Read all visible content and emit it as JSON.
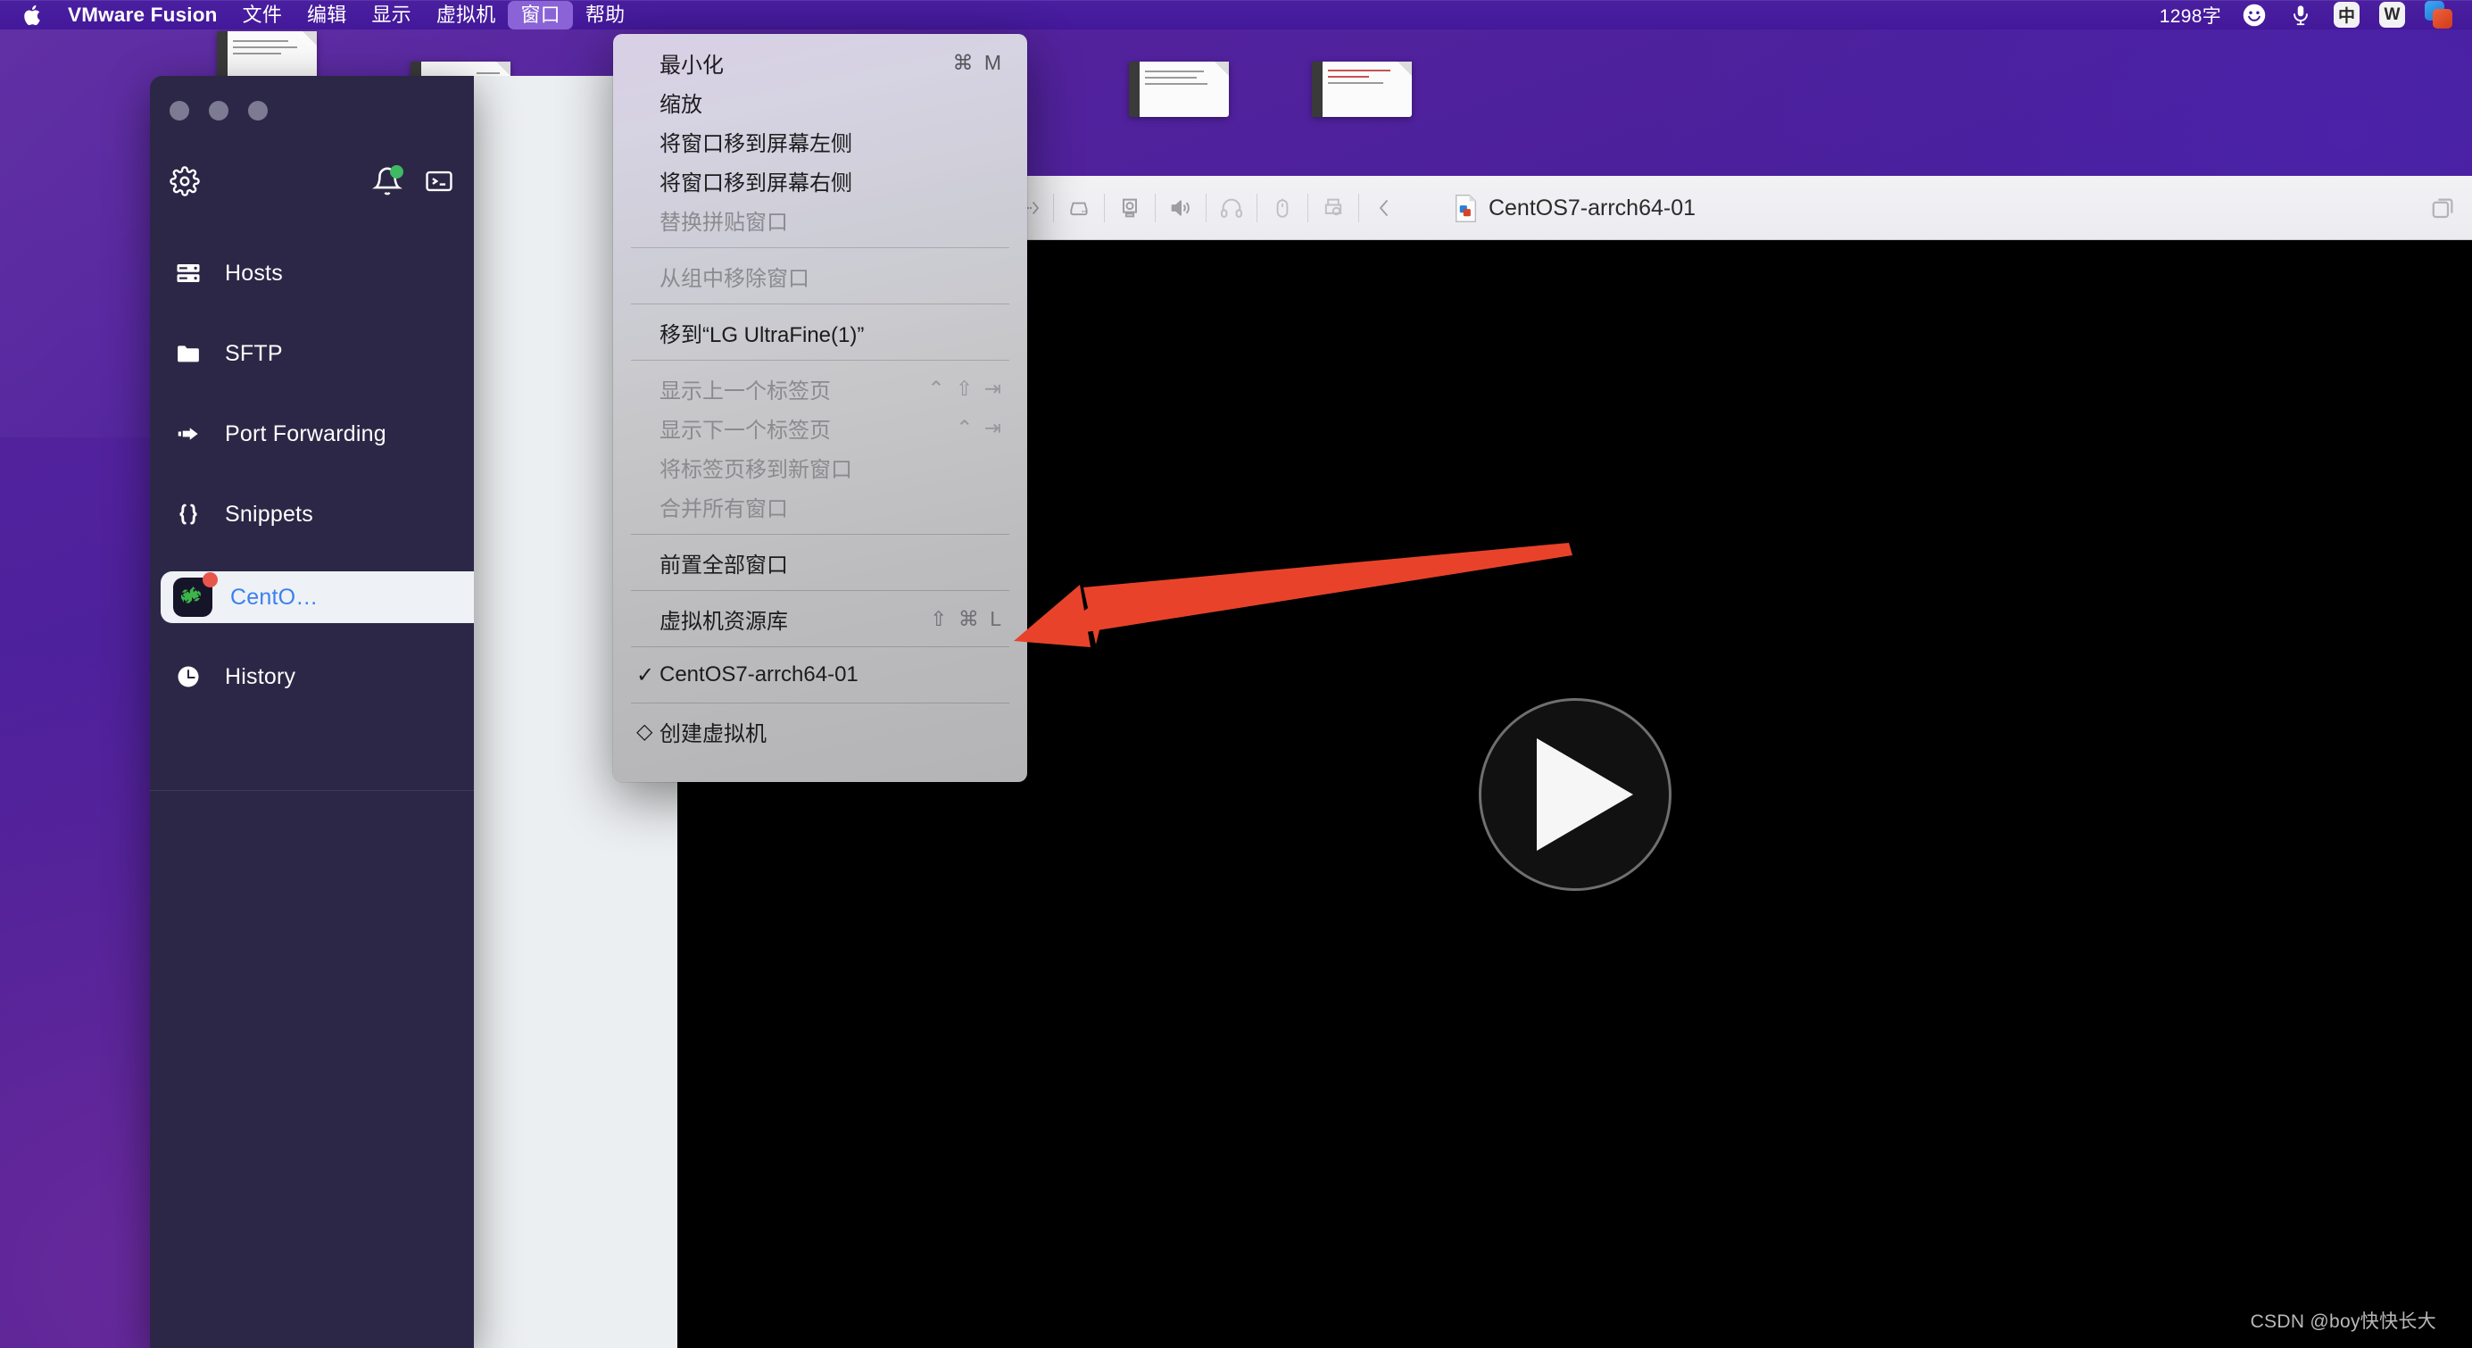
{
  "menubar": {
    "apple_icon": "apple-logo-icon",
    "app_name": "VMware Fusion",
    "items": [
      {
        "label": "文件",
        "active": false
      },
      {
        "label": "编辑",
        "active": false
      },
      {
        "label": "显示",
        "active": false
      },
      {
        "label": "虚拟机",
        "active": false
      },
      {
        "label": "窗口",
        "active": true
      },
      {
        "label": "帮助",
        "active": false
      }
    ],
    "status": {
      "word_count": "1298字",
      "smiley_icon": "smiley-face-icon",
      "microphone_icon": "microphone-icon",
      "ime_label": "中",
      "wps_label": "W",
      "vmware_icon": "vmware-fusion-icon"
    }
  },
  "window_menu": {
    "groups": [
      [
        {
          "label": "最小化",
          "shortcut": "⌘ M",
          "enabled": true,
          "mark": ""
        },
        {
          "label": "缩放",
          "shortcut": "",
          "enabled": true,
          "mark": ""
        },
        {
          "label": "将窗口移到屏幕左侧",
          "shortcut": "",
          "enabled": true,
          "mark": ""
        },
        {
          "label": "将窗口移到屏幕右侧",
          "shortcut": "",
          "enabled": true,
          "mark": ""
        },
        {
          "label": "替换拼贴窗口",
          "shortcut": "",
          "enabled": false,
          "mark": ""
        }
      ],
      [
        {
          "label": "从组中移除窗口",
          "shortcut": "",
          "enabled": false,
          "mark": ""
        }
      ],
      [
        {
          "label": "移到“LG UltraFine(1)”",
          "shortcut": "",
          "enabled": true,
          "mark": ""
        }
      ],
      [
        {
          "label": "显示上一个标签页",
          "shortcut": "⌃ ⇧ ⇥",
          "enabled": false,
          "mark": ""
        },
        {
          "label": "显示下一个标签页",
          "shortcut": "⌃ ⇥",
          "enabled": false,
          "mark": ""
        },
        {
          "label": "将标签页移到新窗口",
          "shortcut": "",
          "enabled": false,
          "mark": ""
        },
        {
          "label": "合并所有窗口",
          "shortcut": "",
          "enabled": false,
          "mark": ""
        }
      ],
      [
        {
          "label": "前置全部窗口",
          "shortcut": "",
          "enabled": true,
          "mark": ""
        }
      ],
      [
        {
          "label": "虚拟机资源库",
          "shortcut": "⇧ ⌘ L",
          "enabled": true,
          "mark": ""
        }
      ],
      [
        {
          "label": "CentOS7-arrch64-01",
          "shortcut": "",
          "enabled": true,
          "mark": "✓"
        }
      ],
      [
        {
          "label": "创建虚拟机",
          "shortcut": "",
          "enabled": true,
          "mark": "◇"
        }
      ]
    ]
  },
  "terminal_app": {
    "traffic_lights": [
      "close-button",
      "minimize-button",
      "maximize-button"
    ],
    "toolbar": {
      "settings_icon": "gear-icon",
      "notifications_icon": "bell-icon",
      "notification_dot_color": "#3fb964",
      "terminal_icon": "terminal-icon"
    },
    "nav_items": [
      {
        "label": "Hosts",
        "icon": "server-icon",
        "selected": false
      },
      {
        "label": "SFTP",
        "icon": "folder-icon",
        "selected": false
      },
      {
        "label": "Port Forwarding",
        "icon": "port-forward-arrow-icon",
        "selected": false
      },
      {
        "label": "Snippets",
        "icon": "braces-icon",
        "selected": false
      },
      {
        "label": "CentO…",
        "icon": "centos-icon",
        "selected": true,
        "badge_color": "#e8554c"
      },
      {
        "label": "History",
        "icon": "clock-icon",
        "selected": false
      }
    ]
  },
  "vmware_window": {
    "title": "CentOS7-arrch64-01",
    "title_icon": "vm-document-icon",
    "toolbar_icons": [
      "settings-partial-icon",
      "network-icon",
      "hard-disk-icon",
      "camera-icon",
      "sound-icon",
      "headphones-icon",
      "mouse-icon",
      "printer-icon",
      "collapse-chevron-icon"
    ],
    "right_icon": "window-copy-icon",
    "screen": {
      "play_button": "play-button",
      "background_color": "#000000"
    },
    "watermark": "CSDN @boy快快长大"
  },
  "annotation": {
    "arrow_color": "#e8432a",
    "points_to": "虚拟机资源库"
  },
  "theme": {
    "desktop_purple": "#4c209b",
    "menubar_purple": "#43189a",
    "menu_highlight": "#8a63d6",
    "sidebar_bg": "#2c2746",
    "selected_item_bg": "#eef1f5",
    "selected_item_text": "#3b7ff0",
    "toolbar_bg": "#ececf0"
  }
}
